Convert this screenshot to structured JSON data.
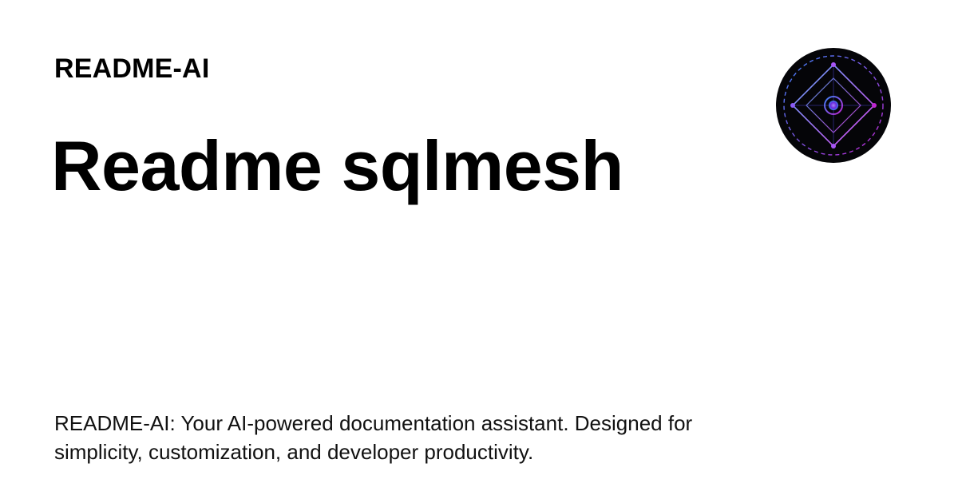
{
  "header": {
    "brand": "README-AI"
  },
  "main": {
    "title": "Readme sqlmesh",
    "description": "README-AI: Your AI-powered documentation assistant. Designed for simplicity, customization, and developer productivity."
  },
  "logo": {
    "icon": "diamond-target-logo-icon",
    "colors": {
      "background": "#050508",
      "accent_blue": "#3b82f6",
      "accent_purple": "#c026d3"
    }
  }
}
